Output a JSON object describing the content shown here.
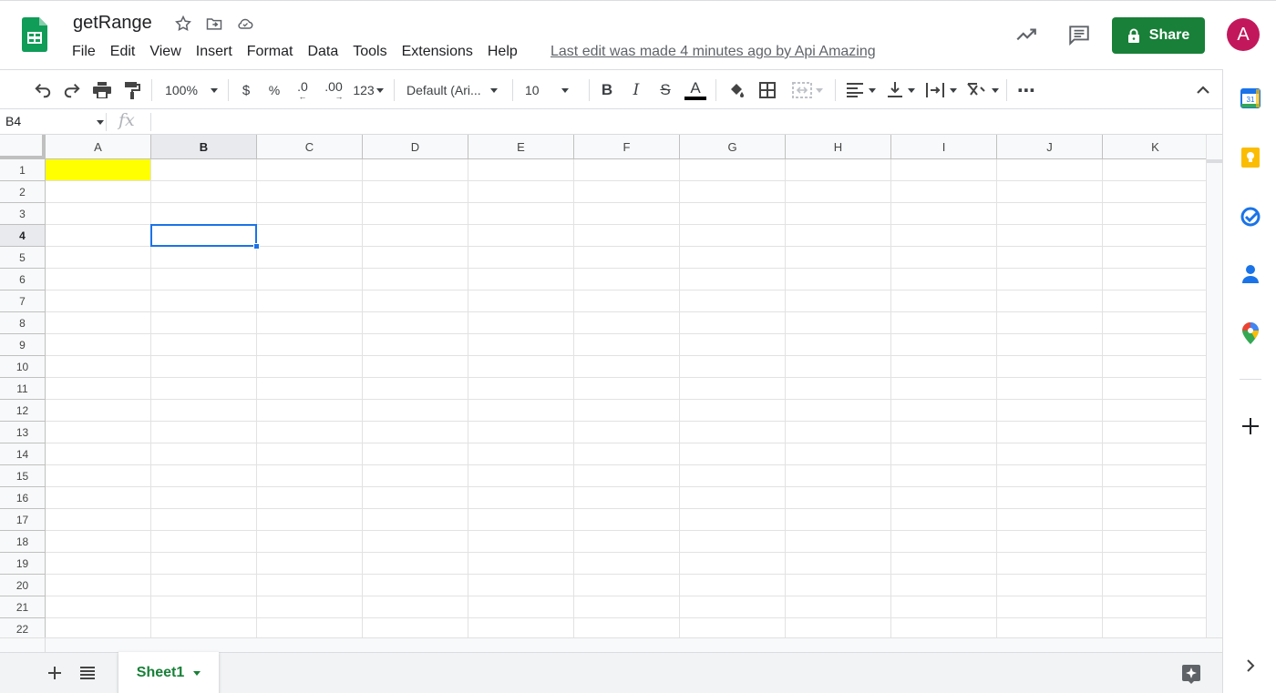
{
  "app": {
    "title": "getRange",
    "last_edit": "Last edit was made 4 minutes ago by Api Amazing",
    "share_label": "Share",
    "avatar_initial": "A"
  },
  "menu": [
    "File",
    "Edit",
    "View",
    "Insert",
    "Format",
    "Data",
    "Tools",
    "Extensions",
    "Help"
  ],
  "toolbar": {
    "zoom": "100%",
    "currency": "$",
    "percent": "%",
    "decrease_decimal": ".0",
    "increase_decimal": ".00",
    "more_formats": "123",
    "font": "Default (Ari...",
    "font_size": "10",
    "bold": "B",
    "italic": "I",
    "strikethrough": "S",
    "text_color": "A",
    "more": "⋯"
  },
  "formula_bar": {
    "name_box": "B4",
    "fx": "fx",
    "value": ""
  },
  "grid": {
    "columns": [
      "A",
      "B",
      "C",
      "D",
      "E",
      "F",
      "G",
      "H",
      "I",
      "J",
      "K"
    ],
    "rows": [
      "1",
      "2",
      "3",
      "4",
      "5",
      "6",
      "7",
      "8",
      "9",
      "10",
      "11",
      "12",
      "13",
      "14",
      "15",
      "16",
      "17",
      "18",
      "19",
      "20",
      "21",
      "22"
    ],
    "active_cell": "B4",
    "highlighted_cell": "A1",
    "highlight_color": "#ffff00"
  },
  "sheets": {
    "active": "Sheet1"
  },
  "colors": {
    "brand_green": "#188038",
    "selection_blue": "#1a73e8",
    "avatar": "#c2185b"
  },
  "side_panel": [
    "calendar-icon",
    "keep-icon",
    "tasks-icon",
    "contacts-icon",
    "maps-icon",
    "add-icon"
  ]
}
